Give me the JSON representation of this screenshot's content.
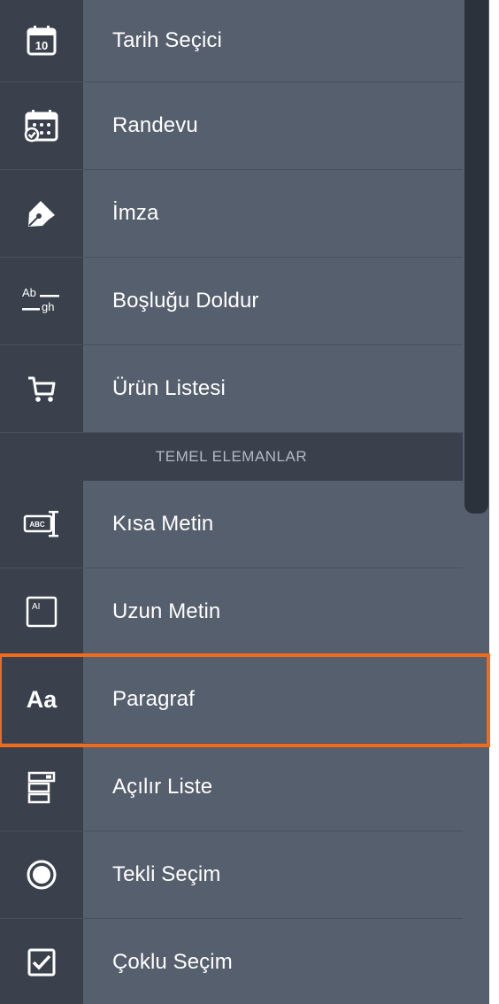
{
  "items_top": [
    {
      "label": "Tarih Seçici",
      "icon": "calendar-date-icon",
      "day": "10"
    },
    {
      "label": "Randevu",
      "icon": "appointment-calendar-icon"
    },
    {
      "label": "İmza",
      "icon": "pen-signature-icon"
    },
    {
      "label": "Boşluğu Doldur",
      "icon": "fill-blank-icon",
      "icon_text_top": "Ab",
      "icon_text_bottom": "gh"
    },
    {
      "label": "Ürün Listesi",
      "icon": "shopping-cart-icon"
    }
  ],
  "section": {
    "title": "TEMEL ELEMANLAR"
  },
  "items_bottom": [
    {
      "label": "Kısa Metin",
      "icon": "short-text-icon",
      "icon_text": "ABC"
    },
    {
      "label": "Uzun Metin",
      "icon": "long-text-icon",
      "icon_text": "AI"
    },
    {
      "label": "Paragraf",
      "icon": "paragraph-icon",
      "icon_text": "Aa"
    },
    {
      "label": "Açılır Liste",
      "icon": "dropdown-list-icon"
    },
    {
      "label": "Tekli Seçim",
      "icon": "radio-button-icon"
    },
    {
      "label": "Çoklu Seçim",
      "icon": "checkbox-icon"
    }
  ],
  "colors": {
    "highlight": "#f26b1d",
    "row": "#565f6d",
    "icon_column": "#3a414d"
  }
}
